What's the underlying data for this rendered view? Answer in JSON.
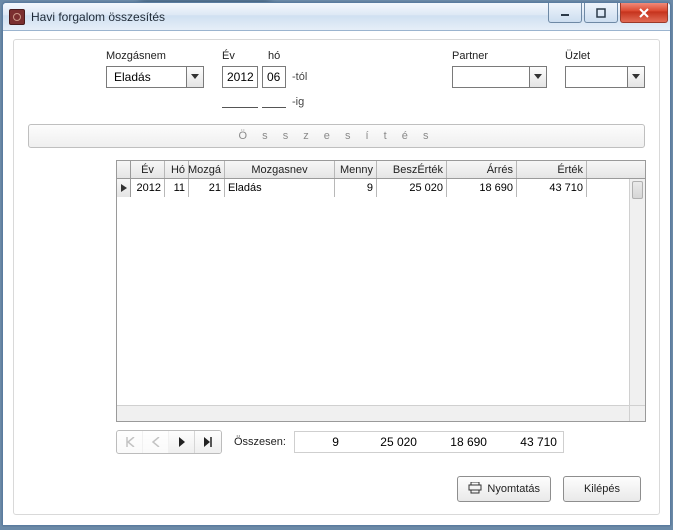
{
  "window": {
    "title": "Havi forgalom összesítés"
  },
  "labels": {
    "mozgasnem": "Mozgásnem",
    "ev": "Év",
    "ho": "hó",
    "partner": "Partner",
    "uzlet": "Üzlet",
    "tol": "-tól",
    "ig": "-ig",
    "osszesites_btn": "Ö s s z e s í t é s",
    "osszesen": "Összesen:",
    "nyomtatas": "Nyomtatás",
    "kilepes": "Kilépés"
  },
  "filters": {
    "mozgasnem_value": "Eladás",
    "ev_from": "2012",
    "ho_from": "06",
    "ev_to": "",
    "ho_to": "",
    "partner_value": "",
    "uzlet_value": ""
  },
  "grid": {
    "headers": {
      "ev": "Év",
      "ho": "Hó",
      "mozgas": "Mozgá",
      "mozgasnev": "Mozgasnev",
      "menny": "Menny",
      "beszertek": "BeszÉrték",
      "arres": "Árrés",
      "ertek": "Érték"
    },
    "rows": [
      {
        "ev": "2012",
        "ho": "11",
        "mozgas": "21",
        "mozgasnev": "Eladás",
        "menny": "9",
        "beszertek": "25 020",
        "arres": "18 690",
        "ertek": "43 710"
      }
    ]
  },
  "totals": {
    "menny": "9",
    "beszertek": "25 020",
    "arres": "18 690",
    "ertek": "43 710"
  }
}
